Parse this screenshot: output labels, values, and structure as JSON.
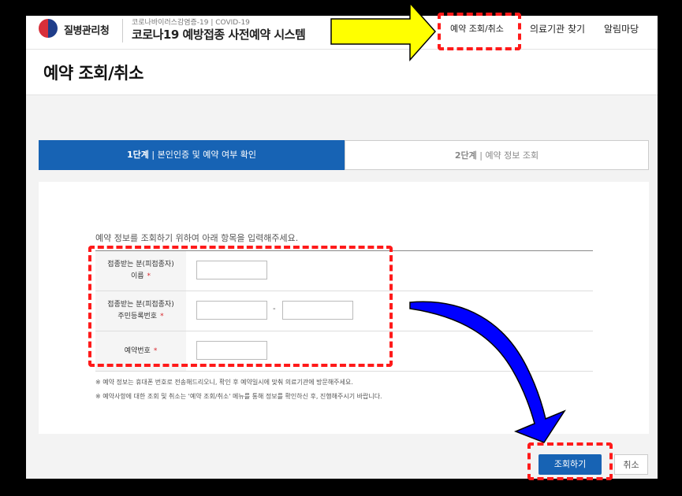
{
  "header": {
    "logo_text": "질병관리청",
    "system_subtitle": "코로나바이러스감염증-19 | COVID-19",
    "system_title": "코로나19 예방접종 사전예약 시스템",
    "nav": [
      "예약 조회/취소",
      "의료기관 찾기",
      "알림마당"
    ]
  },
  "page_title": "예약 조회/취소",
  "steps": [
    {
      "num": "1단계",
      "sep": " | ",
      "text": "본인인증 및 예약 여부 확인",
      "active": true
    },
    {
      "num": "2단계",
      "sep": " | ",
      "text": "예약 정보 조회",
      "active": false
    }
  ],
  "form": {
    "intro": "예약 정보를 조회하기 위하여 아래 항목을 입력해주세요.",
    "rows": [
      {
        "line1": "접종받는 분(피접종자)",
        "line2": "이름",
        "required_mark": "*"
      },
      {
        "line1": "접종받는 분(피접종자)",
        "line2": "주민등록번호",
        "required_mark": "*"
      },
      {
        "line1": "예약번호",
        "line2": "",
        "required_mark": "*"
      }
    ],
    "id_separator": "-",
    "notes": [
      "※ 예약 정보는 휴대폰 번호로 전송해드리오니, 확인 후 예약일시에 맞춰 의료기관에 방문해주세요.",
      "※ 예약사항에 대한 조회 및 취소는 '예약 조회/취소' 메뉴를 통해 정보를 확인하신 후, 진행해주시기 바랍니다."
    ]
  },
  "buttons": {
    "search": "조회하기",
    "cancel": "취소"
  },
  "colors": {
    "primary": "#1763b4",
    "highlight": "#ff1a1a",
    "arrow_yellow": "#ffff00",
    "arrow_blue": "#0000ff"
  }
}
